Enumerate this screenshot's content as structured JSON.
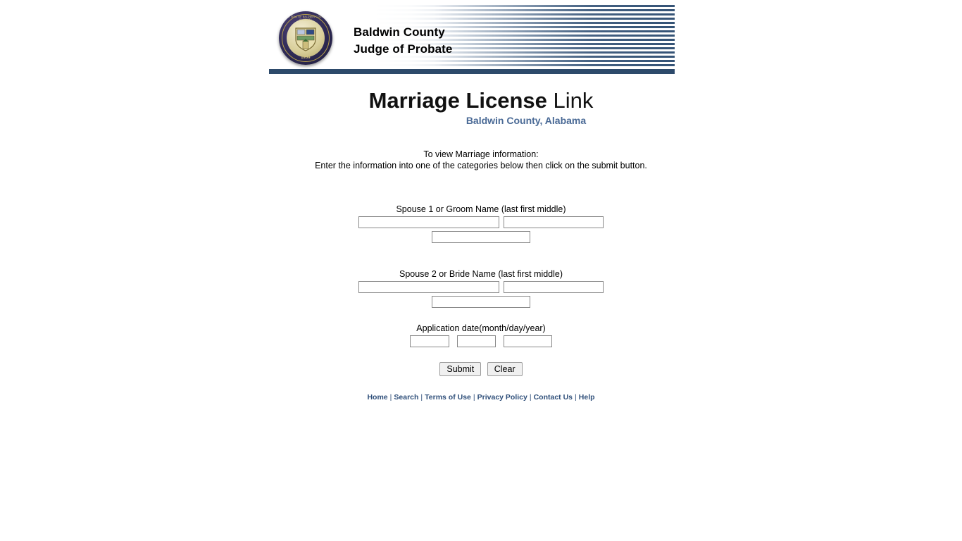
{
  "header": {
    "seal": {
      "ring_text_top": "THE SEAL OF BALDWIN COUNTY ALABAMA",
      "year": "1809"
    },
    "agency_line1": "Baldwin County",
    "agency_line2": "Judge of Probate",
    "rule_color": "#2d4a6b",
    "stripe_color": "#3a5878"
  },
  "title": {
    "main_strong": "Marriage License",
    "main_light": " Link",
    "subtitle": "Baldwin County, Alabama",
    "subtitle_color": "#4a6a96"
  },
  "instructions": {
    "line1": "To view Marriage information:",
    "line2": "Enter the information into one of the categories below then click on the submit button."
  },
  "form": {
    "spouse1": {
      "label": "Spouse 1 or Groom Name (last first middle)",
      "last_value": "",
      "first_value": "",
      "middle_value": ""
    },
    "spouse2": {
      "label": "Spouse 2 or Bride Name (last first middle)",
      "last_value": "",
      "first_value": "",
      "middle_value": ""
    },
    "application_date": {
      "label": "Application date(month/day/year)",
      "month_value": "",
      "day_value": "",
      "year_value": ""
    },
    "submit_label": "Submit",
    "clear_label": "Clear"
  },
  "footer": {
    "links": [
      {
        "label": "Home"
      },
      {
        "label": "Search"
      },
      {
        "label": "Terms of Use"
      },
      {
        "label": "Privacy Policy"
      },
      {
        "label": "Contact Us"
      },
      {
        "label": "Help"
      }
    ],
    "separator": "|",
    "link_color": "#2f4f7a"
  }
}
